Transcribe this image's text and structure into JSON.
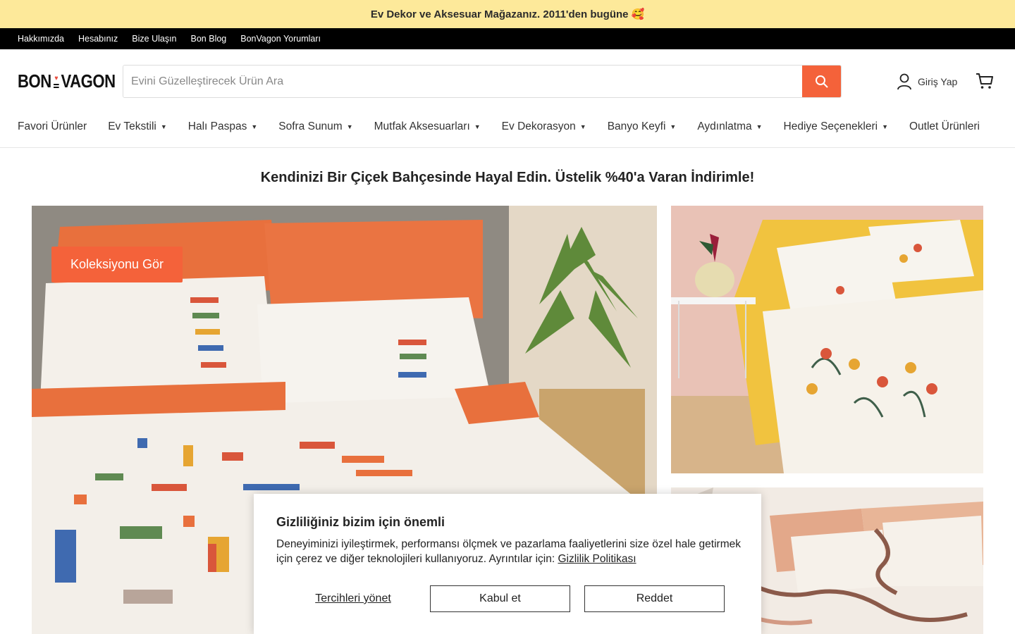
{
  "announcement": {
    "text": "Ev Dekor ve Aksesuar Mağazanız. 2011'den bugüne",
    "emoji": "🥰"
  },
  "utility_nav": [
    "Hakkımızda",
    "Hesabınız",
    "Bize Ulaşın",
    "Bon Blog",
    "BonVagon Yorumları"
  ],
  "logo": {
    "left": "BON",
    "right": "VAGON"
  },
  "search": {
    "placeholder": "Evini Güzelleştirecek Ürün Ara"
  },
  "account": {
    "label": "Giriş Yap"
  },
  "main_nav": [
    {
      "label": "Favori Ürünler",
      "dropdown": false
    },
    {
      "label": "Ev Tekstili",
      "dropdown": true
    },
    {
      "label": "Halı Paspas",
      "dropdown": true
    },
    {
      "label": "Sofra Sunum",
      "dropdown": true
    },
    {
      "label": "Mutfak Aksesuarları",
      "dropdown": true
    },
    {
      "label": "Ev Dekorasyon",
      "dropdown": true
    },
    {
      "label": "Banyo Keyfi",
      "dropdown": true
    },
    {
      "label": "Aydınlatma",
      "dropdown": true
    },
    {
      "label": "Hediye Seçenekleri",
      "dropdown": true
    },
    {
      "label": "Outlet Ürünleri",
      "dropdown": false
    }
  ],
  "headline": "Kendinizi Bir Çiçek Bahçesinde Hayal Edin. Üstelik %40'a Varan İndirimle!",
  "hero": {
    "button": "Koleksiyonu Gör"
  },
  "cookie": {
    "title": "Gizliliğiniz bizim için önemli",
    "body": "Deneyiminizi iyileştirmek, performansı ölçmek ve pazarlama faaliyetlerini size özel hale getirmek için çerez ve diğer teknolojileri kullanıyoruz. Ayrıntılar için: ",
    "link": "Gizlilik Politikası",
    "manage": "Tercihleri yönet",
    "accept": "Kabul et",
    "reject": "Reddet"
  },
  "colors": {
    "announce_bg": "#fde99a",
    "accent": "#f4623a",
    "logo_heart": "#e84c3d"
  }
}
